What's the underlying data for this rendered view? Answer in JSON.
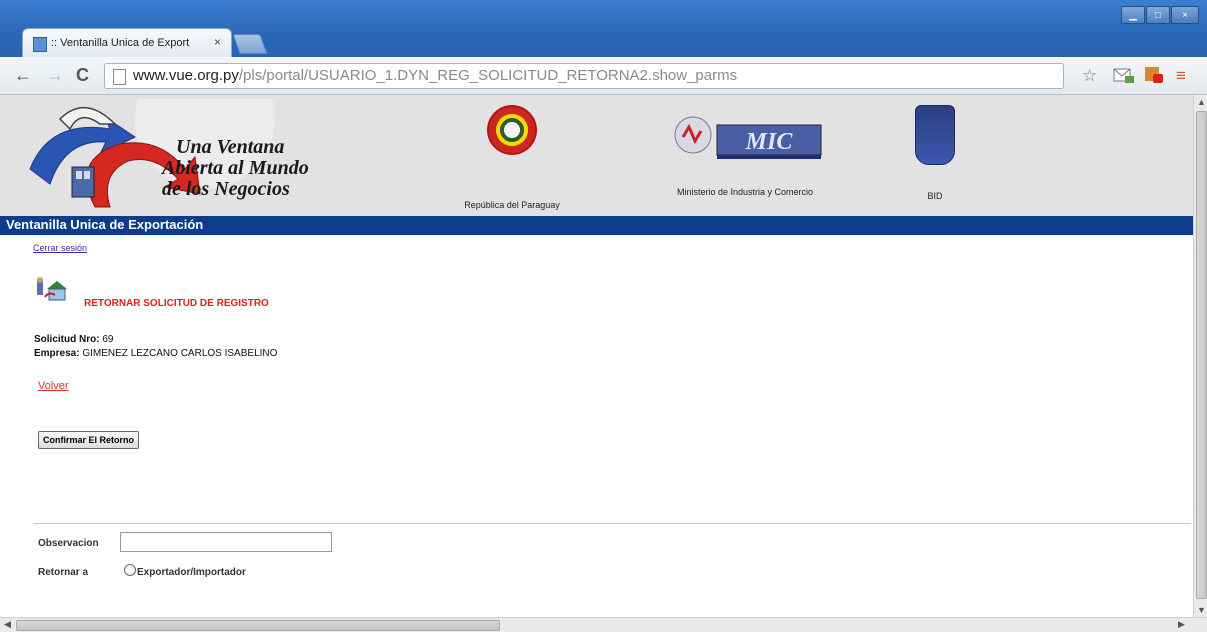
{
  "browser": {
    "tab_title": ":: Ventanilla Unica de Export",
    "tab_close": "×",
    "url_host": "www.vue.org.py",
    "url_path": "/pls/portal/USUARIO_1.DYN_REG_SOLICITUD_RETORNA2.show_parms",
    "nav": {
      "back": "←",
      "forward": "→",
      "reload": "C"
    },
    "star": "☆",
    "menu": "≡"
  },
  "header": {
    "logo_line1": "Una Ventana",
    "logo_line2": "Abierta al Mundo",
    "logo_line3": "de los Negocios",
    "sponsors": [
      {
        "label": "República del Paraguay"
      },
      {
        "label": "Ministerio de Industria y Comercio",
        "logo_text": "MIC"
      },
      {
        "label": "BID"
      }
    ],
    "bar_title": "Ventanilla Unica de Exportación"
  },
  "content": {
    "logout_link": "Cerrar sesión",
    "section_title": "RETORNAR SOLICITUD DE REGISTRO",
    "solicitud_label": "Solicitud Nro:",
    "solicitud_value": "69",
    "empresa_label": "Empresa:",
    "empresa_value": "GIMENEZ LEZCANO CARLOS ISABELINO",
    "volver_link": "Volver",
    "confirm_button": "Confirmar El Retorno",
    "observacion_label": "Observacion",
    "observacion_value": "",
    "retornar_label": "Retornar a",
    "radio_option": "Exportador/Importador"
  },
  "colors": {
    "header_bg": "#e2e2e2",
    "bar_blue": "#0e3b8a",
    "title_red": "#e02020",
    "link_red": "#dd3333"
  }
}
